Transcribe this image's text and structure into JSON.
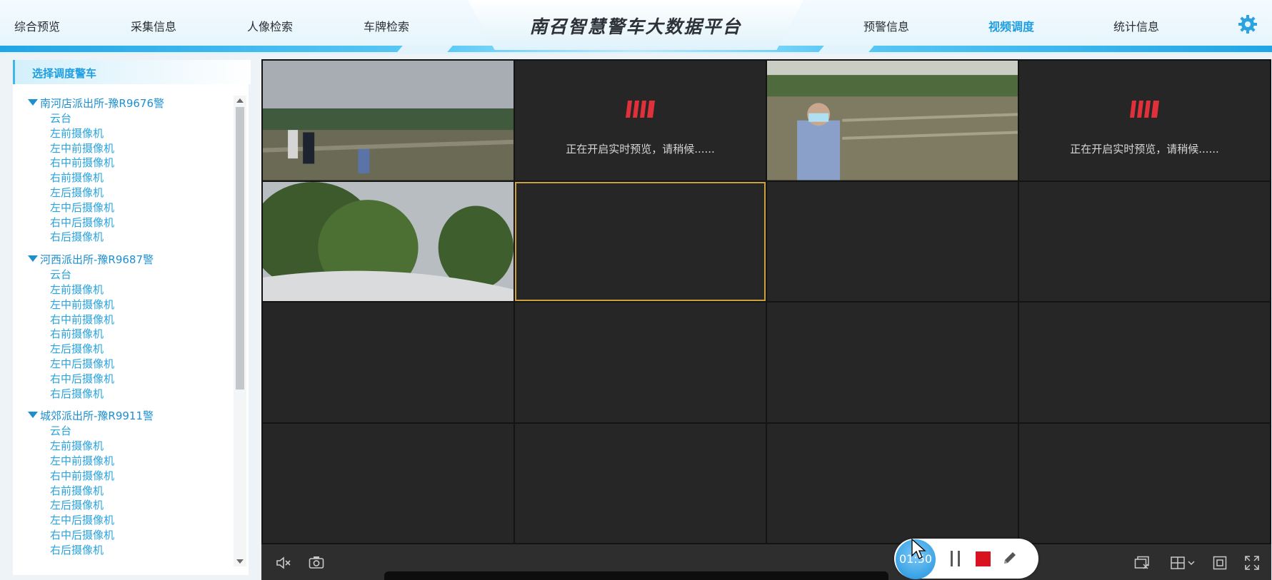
{
  "header": {
    "title": "南召智慧警车大数据平台",
    "nav_left": [
      "综合预览",
      "采集信息",
      "人像检索",
      "车牌检索"
    ],
    "nav_right": [
      "预警信息",
      "视频调度",
      "统计信息"
    ],
    "active_nav": "视频调度",
    "settings_icon": "gear-icon",
    "accent_color": "#1e9ee0"
  },
  "left_panel": {
    "title": "选择调度警车",
    "groups": [
      {
        "name": "南河店派出所-豫R9676警",
        "cameras": [
          "云台",
          "左前摄像机",
          "左中前摄像机",
          "右中前摄像机",
          "右前摄像机",
          "左后摄像机",
          "左中后摄像机",
          "右中后摄像机",
          "右后摄像机"
        ]
      },
      {
        "name": "河西派出所-豫R9687警",
        "cameras": [
          "云台",
          "左前摄像机",
          "左中前摄像机",
          "右中前摄像机",
          "右前摄像机",
          "左后摄像机",
          "左中后摄像机",
          "右中后摄像机",
          "右后摄像机"
        ]
      },
      {
        "name": "城郊派出所-豫R9911警",
        "cameras": [
          "云台",
          "左前摄像机",
          "左中前摄像机",
          "右中前摄像机",
          "右前摄像机",
          "左后摄像机",
          "左中后摄像机",
          "右中后摄像机",
          "右后摄像机"
        ]
      }
    ]
  },
  "video_grid": {
    "rows": 4,
    "cols": 4,
    "loading_text": "正在开启实时预览，请稍候......",
    "selection_color": "#c9a13e",
    "cells": [
      {
        "state": "video",
        "scene": "field-people"
      },
      {
        "state": "loading"
      },
      {
        "state": "video",
        "scene": "field-officer"
      },
      {
        "state": "loading"
      },
      {
        "state": "video",
        "scene": "trees"
      },
      {
        "state": "empty",
        "selected": true
      },
      {
        "state": "empty"
      },
      {
        "state": "empty"
      },
      {
        "state": "empty"
      },
      {
        "state": "empty"
      },
      {
        "state": "empty"
      },
      {
        "state": "empty"
      },
      {
        "state": "empty"
      },
      {
        "state": "empty"
      },
      {
        "state": "empty"
      },
      {
        "state": "empty"
      }
    ]
  },
  "toolbar": {
    "left_icons": [
      "mute-icon",
      "snapshot-icon"
    ],
    "right_icons": [
      "close-all-icon",
      "layout-icon",
      "fit-window-icon",
      "fullscreen-icon"
    ]
  },
  "recorder": {
    "timer": "01:50",
    "controls": [
      "pause-icon",
      "stop-icon",
      "pen-icon"
    ],
    "stop_color": "#d8121f"
  }
}
